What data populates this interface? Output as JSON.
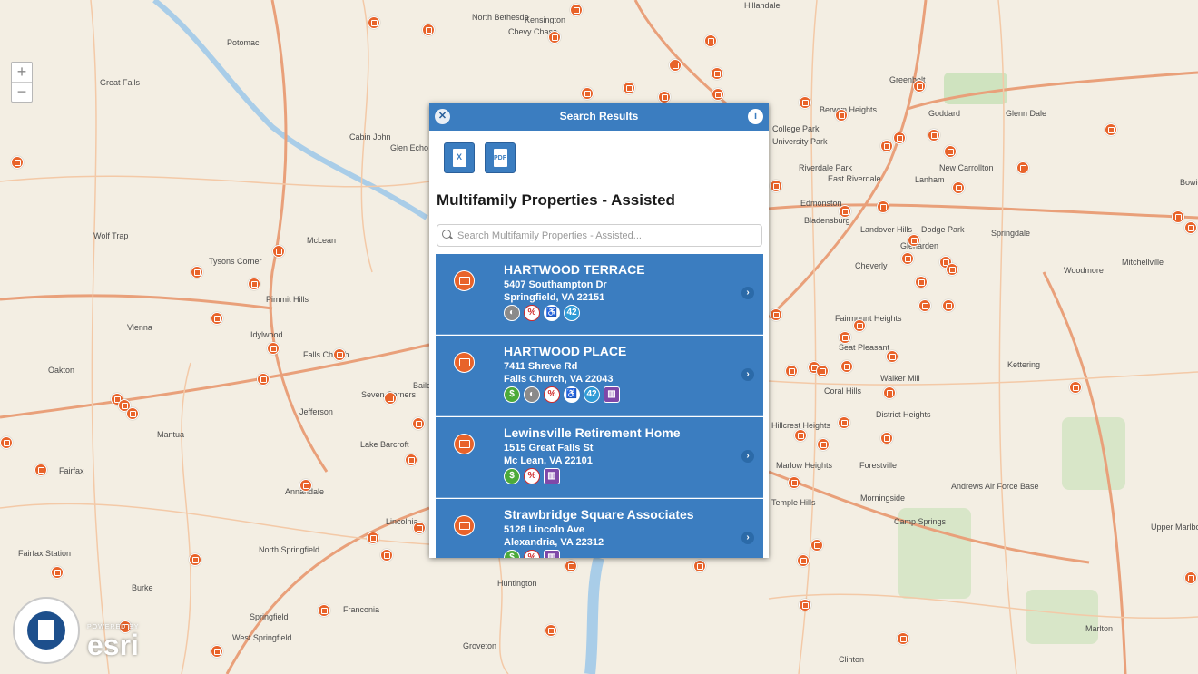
{
  "map": {
    "zoom_in_label": "+",
    "zoom_out_label": "−",
    "places": [
      "Potomac",
      "Great Falls",
      "North Bethesda",
      "Kensington",
      "Chevy Chase",
      "Hillandale",
      "Greenbelt",
      "Berwyn Heights",
      "College Park",
      "University Park",
      "Riverdale Park",
      "East Riverdale",
      "Edmonston",
      "Bladensburg",
      "Lanham",
      "New Carrollton",
      "Glenn Dale",
      "Bowie",
      "Goddard",
      "Landover Hills",
      "Dodge Park",
      "Glenarden",
      "Springdale",
      "Woodmore",
      "Mitchellville",
      "Cheverly",
      "Seat Pleasant",
      "Fairmount Heights",
      "Walker Mill",
      "Kettering",
      "Coral Hills",
      "District Heights",
      "Forestville",
      "Marlow Heights",
      "Morningside",
      "Camp Springs",
      "Andrews Air Force Base",
      "Upper Marlboro",
      "Marlton",
      "Clinton",
      "Cabin John",
      "Glen Echo",
      "Wolf Trap",
      "McLean",
      "Tysons Corner",
      "Pimmit Hills",
      "Idylwood",
      "Vienna",
      "Falls Church",
      "Oakton",
      "Mantua",
      "Jefferson",
      "Lake Barcroft",
      "Fairfax",
      "Annandale",
      "Lincolnia",
      "North Springfield",
      "Fairfax Station",
      "Burke",
      "Springfield",
      "West Springfield",
      "Franconia",
      "Huntington",
      "Groveton",
      "Hillcrest Heights",
      "Temple Hills",
      "Seven Corners",
      "Baileys Crossroads"
    ],
    "pin_icon": "building-icon",
    "accent_color": "#e8632a"
  },
  "logo": {
    "powered_by": "POWERED BY",
    "brand": "esri",
    "seal_name": "hud-seal"
  },
  "panel": {
    "title": "Search Results",
    "close_icon": "close-icon",
    "info_icon": "info-icon",
    "export_excel_label": "X",
    "export_pdf_label": "PDF",
    "layer_title": "Multifamily Properties - Assisted",
    "search_placeholder": "Search Multifamily Properties - Assisted...",
    "header_color": "#3b7dc0",
    "results": [
      {
        "name": "HARTWOOD TERRACE",
        "street": "5407 Southampton Dr",
        "city": "Springfield, VA 22151",
        "badges": [
          {
            "type": "b-pie",
            "label": "◐"
          },
          {
            "type": "b-pct",
            "label": "%"
          },
          {
            "type": "b-ada",
            "label": "♿"
          },
          {
            "type": "b-42",
            "label": "42"
          }
        ]
      },
      {
        "name": "HARTWOOD PLACE",
        "street": "7411 Shreve Rd",
        "city": "Falls Church, VA 22043",
        "badges": [
          {
            "type": "b-money",
            "label": "$"
          },
          {
            "type": "b-pie",
            "label": "◐"
          },
          {
            "type": "b-pct",
            "label": "%"
          },
          {
            "type": "b-ada",
            "label": "♿"
          },
          {
            "type": "b-42",
            "label": "42"
          },
          {
            "type": "b-bldg",
            "label": "▥"
          }
        ]
      },
      {
        "name": "Lewinsville Retirement Home",
        "street": "1515 Great Falls St",
        "city": "Mc Lean, VA 22101",
        "badges": [
          {
            "type": "b-money",
            "label": "$"
          },
          {
            "type": "b-pct",
            "label": "%"
          },
          {
            "type": "b-bldg",
            "label": "▥"
          }
        ]
      },
      {
        "name": "Strawbridge Square Associates",
        "street": "5128 Lincoln Ave",
        "city": "Alexandria, VA 22312",
        "badges": [
          {
            "type": "b-money",
            "label": "$"
          },
          {
            "type": "b-pct",
            "label": "%"
          },
          {
            "type": "b-bldg",
            "label": "▥"
          }
        ]
      }
    ]
  }
}
